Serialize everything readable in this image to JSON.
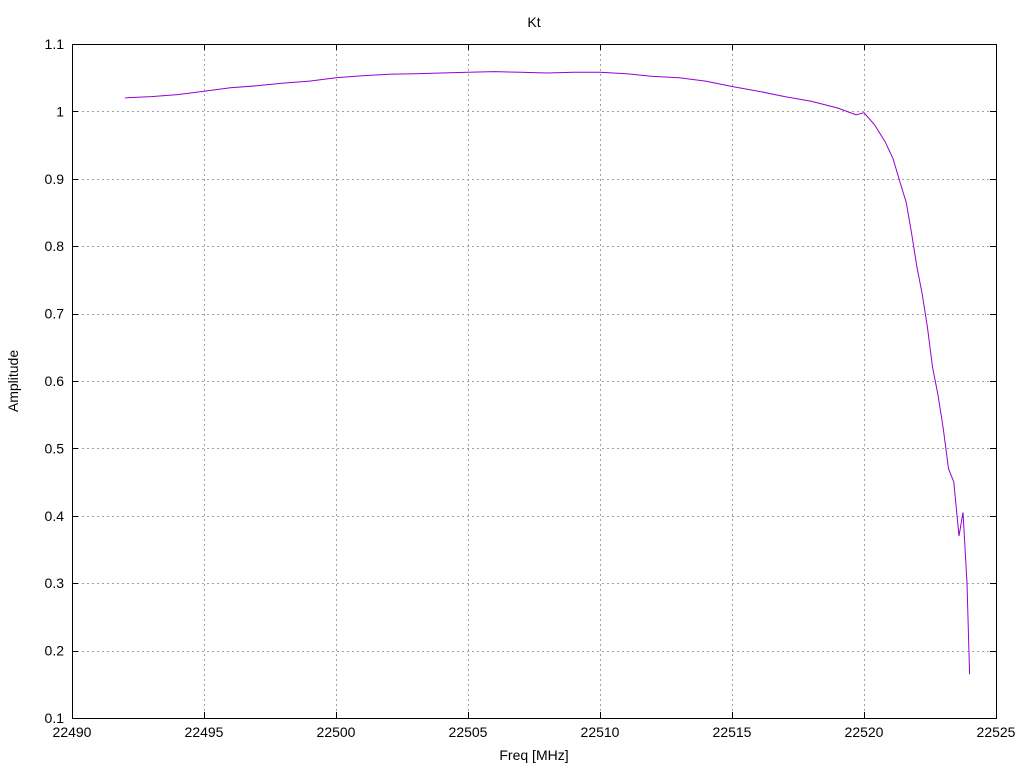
{
  "chart_data": {
    "type": "line",
    "title": "Kt",
    "xlabel": "Freq [MHz]",
    "ylabel": "Amplitude",
    "xlim": [
      22490,
      22525
    ],
    "ylim": [
      0.1,
      1.1
    ],
    "xticks": [
      22490,
      22495,
      22500,
      22505,
      22510,
      22515,
      22520,
      22525
    ],
    "yticks": [
      0.1,
      0.2,
      0.3,
      0.4,
      0.5,
      0.6,
      0.7,
      0.8,
      0.9,
      1,
      1.1
    ],
    "xtick_labels": [
      "22490",
      "22495",
      "22500",
      "22505",
      "22510",
      "22515",
      "22520",
      "22525"
    ],
    "ytick_labels": [
      "0.1",
      "0.2",
      "0.3",
      "0.4",
      "0.5",
      "0.6",
      "0.7",
      "0.8",
      "0.9",
      "1",
      "1.1"
    ],
    "grid": true,
    "series": [
      {
        "color": "#9400d3",
        "x": [
          22492.0,
          22493.0,
          22494.0,
          22495.0,
          22496.0,
          22497.0,
          22498.0,
          22499.0,
          22500.0,
          22501.0,
          22502.0,
          22503.0,
          22504.0,
          22505.0,
          22506.0,
          22507.0,
          22508.0,
          22509.0,
          22510.0,
          22511.0,
          22512.0,
          22513.0,
          22514.0,
          22515.0,
          22516.0,
          22517.0,
          22518.0,
          22519.0,
          22519.7,
          22520.0,
          22520.4,
          22520.8,
          22521.1,
          22521.4,
          22521.6,
          22521.8,
          22522.0,
          22522.2,
          22522.4,
          22522.6,
          22522.8,
          22523.0,
          22523.2,
          22523.4,
          22523.6,
          22523.75,
          22523.9,
          22524.0
        ],
        "y": [
          1.02,
          1.022,
          1.025,
          1.03,
          1.035,
          1.038,
          1.042,
          1.045,
          1.05,
          1.053,
          1.055,
          1.056,
          1.057,
          1.058,
          1.059,
          1.058,
          1.057,
          1.058,
          1.058,
          1.056,
          1.052,
          1.05,
          1.045,
          1.037,
          1.03,
          1.022,
          1.015,
          1.005,
          0.995,
          0.998,
          0.98,
          0.955,
          0.93,
          0.89,
          0.865,
          0.82,
          0.77,
          0.73,
          0.68,
          0.62,
          0.58,
          0.53,
          0.47,
          0.45,
          0.37,
          0.405,
          0.3,
          0.165
        ]
      }
    ]
  }
}
